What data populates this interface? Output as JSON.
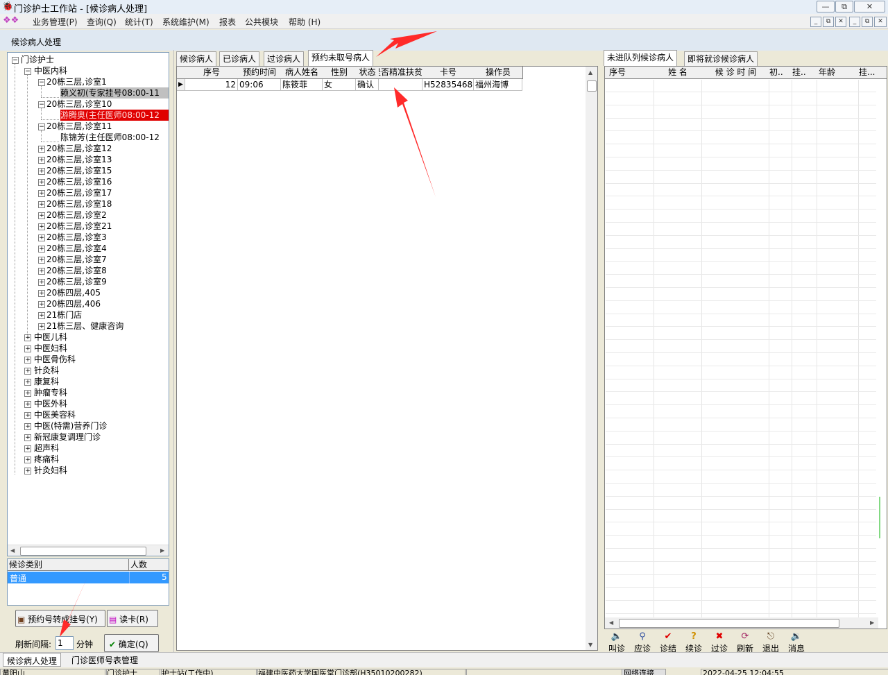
{
  "window": {
    "title": "门诊护士工作站 - [候诊病人处理]",
    "controls": [
      "—",
      "⧉",
      "✕"
    ],
    "mdi_controls": [
      "_",
      "⧉",
      "✕",
      "_",
      "⧉",
      "✕"
    ]
  },
  "menubar": {
    "items": [
      "业务管理(P)",
      "查询(Q)",
      "统计(T)",
      "系统维护(M)",
      "报表",
      "公共模块",
      "帮助 (H)"
    ]
  },
  "header": {
    "label": "候诊病人处理"
  },
  "tree": {
    "root": "门诊护士",
    "dept_open": "中医内科",
    "room1": "20栋三层,诊室1",
    "doc1": "赖义初(专家挂号08:00-11",
    "room10": "20栋三层,诊室10",
    "doc10": "游腾奥(主任医师08:00-12",
    "room11": "20栋三层,诊室11",
    "doc11": "陈锦芳(主任医师08:00-12",
    "rooms": [
      "20栋三层,诊室12",
      "20栋三层,诊室13",
      "20栋三层,诊室15",
      "20栋三层,诊室16",
      "20栋三层,诊室17",
      "20栋三层,诊室18",
      "20栋三层,诊室2",
      "20栋三层,诊室21",
      "20栋三层,诊室3",
      "20栋三层,诊室4",
      "20栋三层,诊室7",
      "20栋三层,诊室8",
      "20栋三层,诊室9",
      "20栋四层,405",
      "20栋四层,406",
      "21栋门店",
      "21栋三层、健康咨询"
    ],
    "depts": [
      "中医儿科",
      "中医妇科",
      "中医骨伤科",
      "针灸科",
      "康复科",
      "肿瘤专科",
      "中医外科",
      "中医美容科",
      "中医(特需)营养门诊",
      "新冠康复调理门诊",
      "超声科",
      "疼痛科",
      "针灸妇科"
    ]
  },
  "category_table": {
    "headers": [
      "候诊类别",
      "人数"
    ],
    "row": {
      "name": "普通",
      "count": "5"
    }
  },
  "buttons": {
    "appointment_to_register": "预约号转成挂号(Y)",
    "read_card": "读卡(R)",
    "refresh_label": "刷新间隔:",
    "refresh_value": "1",
    "refresh_unit": "分钟",
    "confirm": "确定(Q)"
  },
  "center_tabs": [
    "候诊病人",
    "已诊病人",
    "过诊病人",
    "预约未取号病人"
  ],
  "center_grid": {
    "headers": [
      "序号",
      "预约时间",
      "病人姓名",
      "性别",
      "状态",
      "是否精准扶贫",
      "卡号",
      "操作员"
    ],
    "rows": [
      [
        "12",
        "09:06",
        "陈筱菲",
        "女",
        "确认",
        "",
        "H52835468",
        "福州海博"
      ]
    ]
  },
  "right_tabs": [
    "未进队列候诊病人",
    "即将就诊候诊病人"
  ],
  "right_grid": {
    "headers": [
      "序号",
      "姓 名",
      "候 诊 时 间",
      "初..",
      "挂..",
      "年龄",
      "挂..."
    ]
  },
  "toolbar": {
    "items": [
      {
        "label": "叫诊",
        "icon": "speaker-icon"
      },
      {
        "label": "应诊",
        "icon": "stethoscope-icon"
      },
      {
        "label": "诊结",
        "icon": "checkmark-icon"
      },
      {
        "label": "续诊",
        "icon": "question-icon"
      },
      {
        "label": "过诊",
        "icon": "cross-icon"
      },
      {
        "label": "刷新",
        "icon": "refresh-icon"
      },
      {
        "label": "退出",
        "icon": "exit-door-icon"
      },
      {
        "label": "消息",
        "icon": "message-icon"
      }
    ]
  },
  "bottom_tabs": [
    "候诊病人处理",
    "门诊医师号表管理"
  ],
  "statusbar": {
    "cells": [
      "黄阳山",
      "门诊护士",
      "护士站(工作中)",
      "福建中医药大学国医堂门诊部(H35010200282)",
      "",
      "网络连接",
      "2022-04-25 12:04:55"
    ]
  },
  "colors": {
    "selection_blue": "#3399ff",
    "tree_red": "#e00000",
    "annotation_red": "#ff2a2a"
  }
}
